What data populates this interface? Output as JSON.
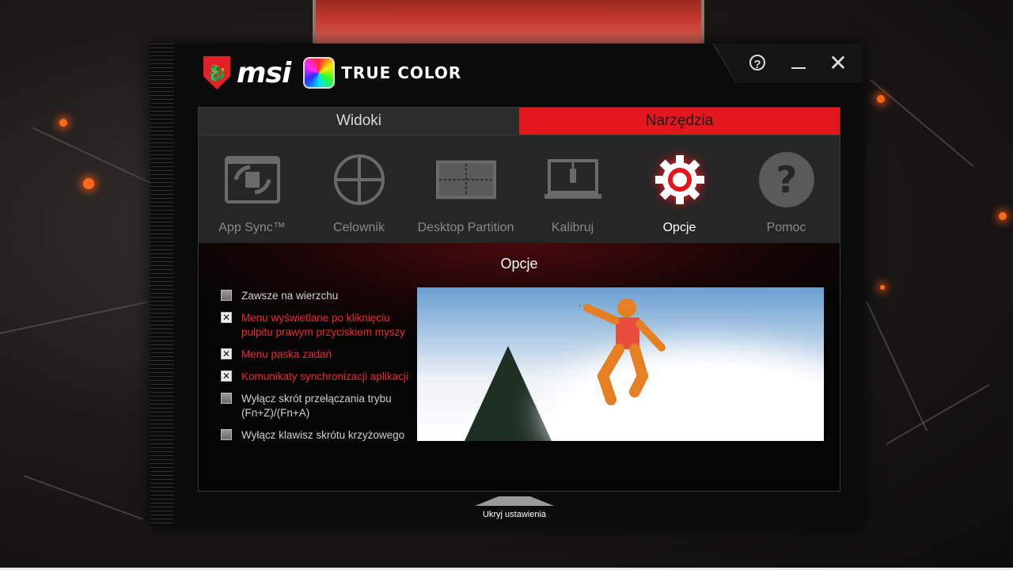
{
  "app": {
    "brand": "msi",
    "product": "TRUE COLOR"
  },
  "window_controls": {
    "help_glyph": "?",
    "close_glyph": "✕"
  },
  "tabs": [
    {
      "label": "Widoki",
      "active": false
    },
    {
      "label": "Narzędzia",
      "active": true
    }
  ],
  "tools": [
    {
      "label": "App Sync™",
      "icon": "app-sync-icon",
      "active": false
    },
    {
      "label": "Celownik",
      "icon": "crosshair-icon",
      "active": false
    },
    {
      "label": "Desktop Partition",
      "icon": "desktop-partition-icon",
      "active": false
    },
    {
      "label": "Kalibruj",
      "icon": "calibrate-laptop-icon",
      "active": false
    },
    {
      "label": "Opcje",
      "icon": "gear-icon",
      "active": true
    },
    {
      "label": "Pomoc",
      "icon": "help-icon",
      "active": false
    }
  ],
  "panel": {
    "title": "Opcje",
    "options": [
      {
        "label": "Zawsze na wierzchu",
        "checked": false
      },
      {
        "label": "Menu wyświetlane po kliknięciu pulpitu prawym przyciskiem myszy",
        "checked": true
      },
      {
        "label": "Menu paska zadań",
        "checked": true
      },
      {
        "label": "Komunikaty synchronizacji aplikacji",
        "checked": true
      },
      {
        "label": "Wyłącz skrót przełączania trybu (Fn+Z)/(Fn+A)",
        "checked": false
      },
      {
        "label": "Wyłącz klawisz skrótu krzyżowego",
        "checked": false
      }
    ]
  },
  "footer": {
    "hide_settings_label": "Ukryj ustawienia"
  },
  "colors": {
    "accent": "#e3161d",
    "checked_text": "#f0262c"
  }
}
